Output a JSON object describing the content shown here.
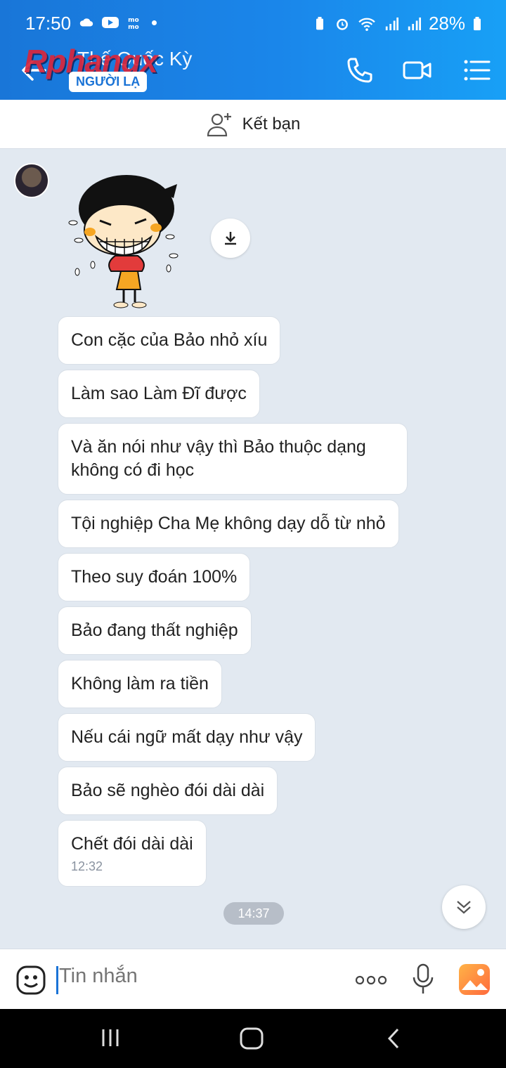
{
  "status_bar": {
    "time": "17:50",
    "battery": "28%",
    "icons": [
      "cloud-icon",
      "youtube-icon",
      "momo-icon",
      "notification-dot",
      "battery-saver-icon",
      "alarm-icon",
      "wifi-icon",
      "signal-icon",
      "signal-icon",
      "battery-icon"
    ]
  },
  "header": {
    "watermark": "Rphangx",
    "contact_name": "Thế Quốc Kỳ",
    "badge": "NGƯỜI LẠ",
    "icons": [
      "back-arrow-icon",
      "phone-icon",
      "video-call-icon",
      "menu-list-icon"
    ]
  },
  "add_friend": {
    "label": "Kết bạn",
    "icon": "add-user-icon"
  },
  "messages": [
    {
      "text": "Con cặc của Bảo nhỏ xíu"
    },
    {
      "text": "Làm sao Làm Đĩ được"
    },
    {
      "text": "Và ăn nói như vậy thì Bảo thuộc dạng không có đi học"
    },
    {
      "text": "Tội nghiệp Cha Mẹ không dạy dỗ từ nhỏ"
    },
    {
      "text": "Theo suy đoán 100%"
    },
    {
      "text": "Bảo đang thất nghiệp"
    },
    {
      "text": "Không làm ra tiền"
    },
    {
      "text": "Nếu cái ngữ mất dạy như vậy"
    },
    {
      "text": "Bảo sẽ nghèo đói dài dài"
    },
    {
      "text": "Chết đói dài dài",
      "time": "12:32"
    }
  ],
  "time_separator": "14:37",
  "input": {
    "placeholder": "Tin nhắn"
  },
  "colors": {
    "header_start": "#1976d8",
    "header_end": "#18a0f6",
    "chat_bg": "#e2e9f1",
    "accent": "#1a73d6"
  }
}
